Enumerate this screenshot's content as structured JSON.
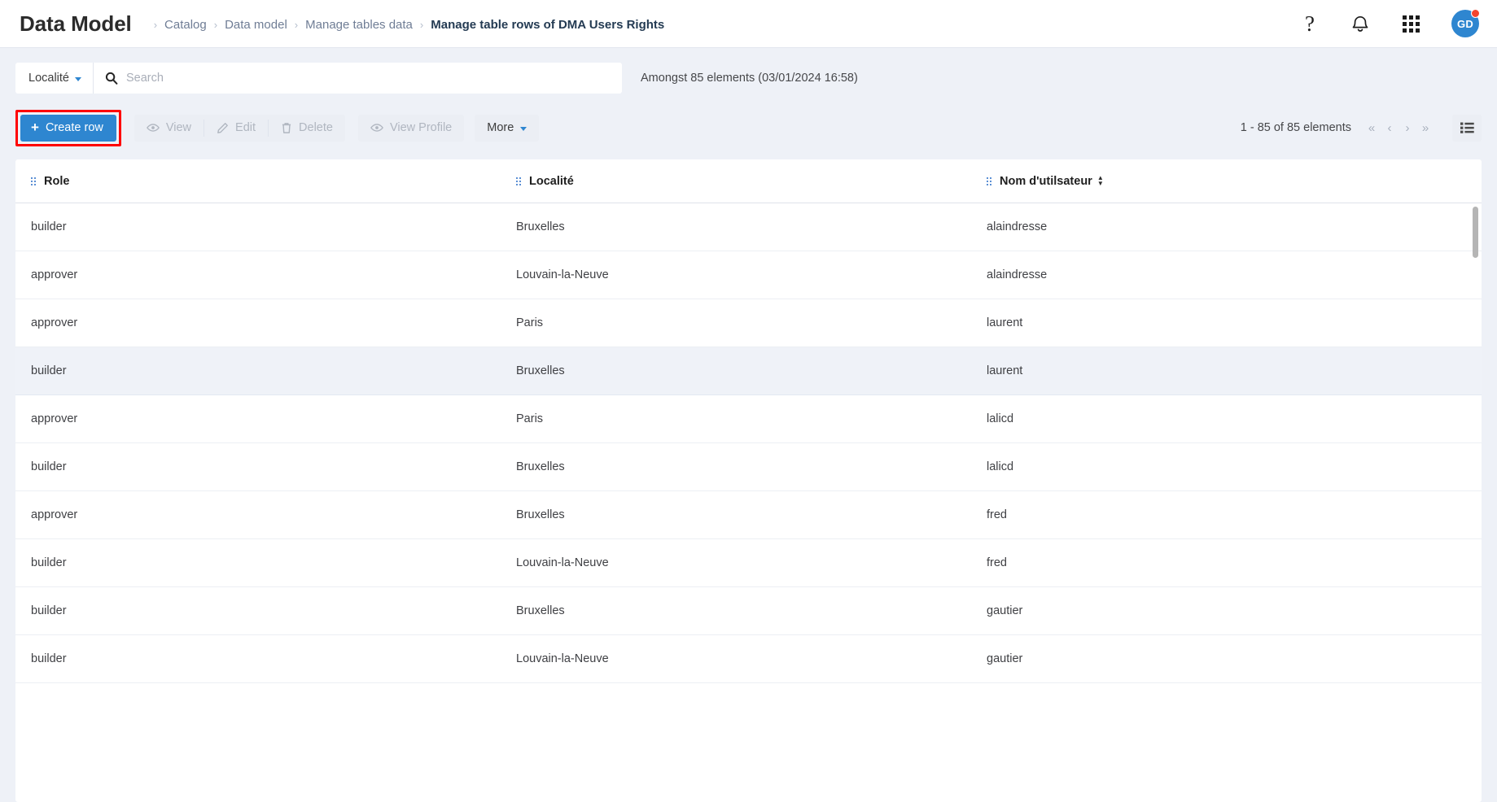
{
  "header": {
    "app_title": "Data Model",
    "breadcrumb": [
      {
        "label": "Catalog",
        "active": false
      },
      {
        "label": "Data model",
        "active": false
      },
      {
        "label": "Manage tables data",
        "active": false
      },
      {
        "label": "Manage table rows of DMA Users Rights",
        "active": true
      }
    ],
    "icons": {
      "help": "help-icon",
      "notifications": "bell-icon",
      "apps": "apps-grid-icon"
    },
    "avatar_initials": "GD",
    "avatar_color": "#2e86d0",
    "badge_color": "#f2452e"
  },
  "search": {
    "scope_label": "Localité",
    "placeholder": "Search",
    "value": "",
    "summary": "Amongst 85 elements (03/01/2024 16:58)"
  },
  "toolbar": {
    "create_label": "Create row",
    "view_label": "View",
    "edit_label": "Edit",
    "delete_label": "Delete",
    "view_profile_label": "View Profile",
    "more_label": "More",
    "highlight_color": "#ff0000",
    "primary_color": "#2e86d0"
  },
  "pagination": {
    "range_label": "1 - 85 of 85 elements",
    "first": "«",
    "prev": "‹",
    "next": "›",
    "last": "»"
  },
  "table": {
    "columns": [
      {
        "label": "Role",
        "sortable": false
      },
      {
        "label": "Localité",
        "sortable": false
      },
      {
        "label": "Nom d'utilsateur",
        "sortable": true
      }
    ],
    "rows": [
      {
        "role": "builder",
        "localite": "Bruxelles",
        "user": "alaindresse",
        "selected": false
      },
      {
        "role": "approver",
        "localite": "Louvain-la-Neuve",
        "user": "alaindresse",
        "selected": false
      },
      {
        "role": "approver",
        "localite": "Paris",
        "user": "laurent",
        "selected": false
      },
      {
        "role": "builder",
        "localite": "Bruxelles",
        "user": "laurent",
        "selected": true
      },
      {
        "role": "approver",
        "localite": "Paris",
        "user": "lalicd",
        "selected": false
      },
      {
        "role": "builder",
        "localite": "Bruxelles",
        "user": "lalicd",
        "selected": false
      },
      {
        "role": "approver",
        "localite": "Bruxelles",
        "user": "fred",
        "selected": false
      },
      {
        "role": "builder",
        "localite": "Louvain-la-Neuve",
        "user": "fred",
        "selected": false
      },
      {
        "role": "builder",
        "localite": "Bruxelles",
        "user": "gautier",
        "selected": false
      },
      {
        "role": "builder",
        "localite": "Louvain-la-Neuve",
        "user": "gautier",
        "selected": false
      }
    ]
  }
}
